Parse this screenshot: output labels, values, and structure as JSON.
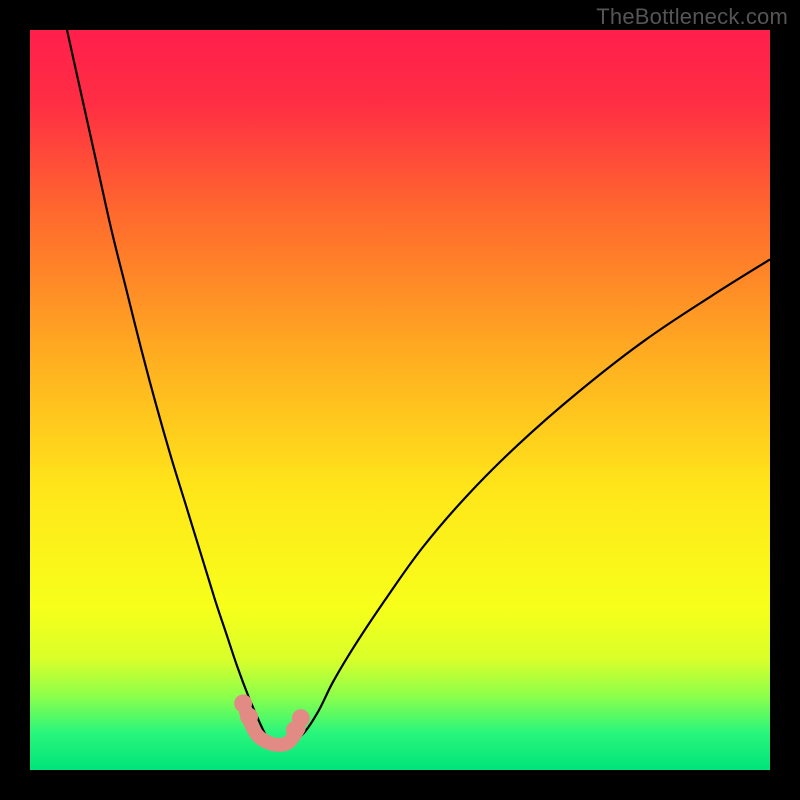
{
  "watermark": "TheBottleneck.com",
  "chart_data": {
    "type": "line",
    "title": "",
    "xlabel": "",
    "ylabel": "",
    "xlim": [
      0,
      100
    ],
    "ylim": [
      0,
      100
    ],
    "background_gradient": {
      "stops": [
        {
          "pos": 0.0,
          "color": "#ff1f4b"
        },
        {
          "pos": 0.1,
          "color": "#ff2e44"
        },
        {
          "pos": 0.25,
          "color": "#ff6a2d"
        },
        {
          "pos": 0.45,
          "color": "#ffb020"
        },
        {
          "pos": 0.62,
          "color": "#ffe61a"
        },
        {
          "pos": 0.78,
          "color": "#f7ff1a"
        },
        {
          "pos": 0.85,
          "color": "#d9ff2a"
        },
        {
          "pos": 0.9,
          "color": "#8dff4a"
        },
        {
          "pos": 0.95,
          "color": "#29f57c"
        },
        {
          "pos": 1.0,
          "color": "#00e47a"
        }
      ]
    },
    "series": [
      {
        "name": "bottleneck-curve",
        "color": "#000000",
        "width": 2.2,
        "x": [
          5,
          7,
          9,
          11,
          13,
          15,
          17,
          19,
          21,
          23,
          25,
          26.5,
          28,
          29.5,
          31,
          32,
          33,
          34,
          35,
          37,
          39,
          41,
          44,
          48,
          53,
          59,
          66,
          74,
          83,
          92,
          100
        ],
        "values": [
          100,
          91,
          82,
          73,
          65,
          57,
          49.5,
          42.5,
          36,
          29.5,
          23,
          18.5,
          14,
          10,
          6.5,
          4.5,
          3.6,
          3.3,
          3.5,
          5,
          8,
          12,
          17,
          23,
          30,
          37,
          44,
          51,
          58,
          64,
          69
        ]
      },
      {
        "name": "highlight-band",
        "color": "#e28b84",
        "width": 14,
        "linecap": "round",
        "x": [
          29.2,
          30.5,
          32,
          33.5,
          35,
          36.3
        ],
        "values": [
          7.8,
          5.0,
          3.8,
          3.4,
          3.8,
          5.6
        ]
      }
    ],
    "markers": {
      "name": "highlight-dots",
      "color": "#e28b84",
      "radius": 9,
      "x": [
        28.8,
        29.6,
        35.8,
        36.6
      ],
      "values": [
        9.0,
        7.2,
        5.4,
        7.0
      ]
    }
  }
}
